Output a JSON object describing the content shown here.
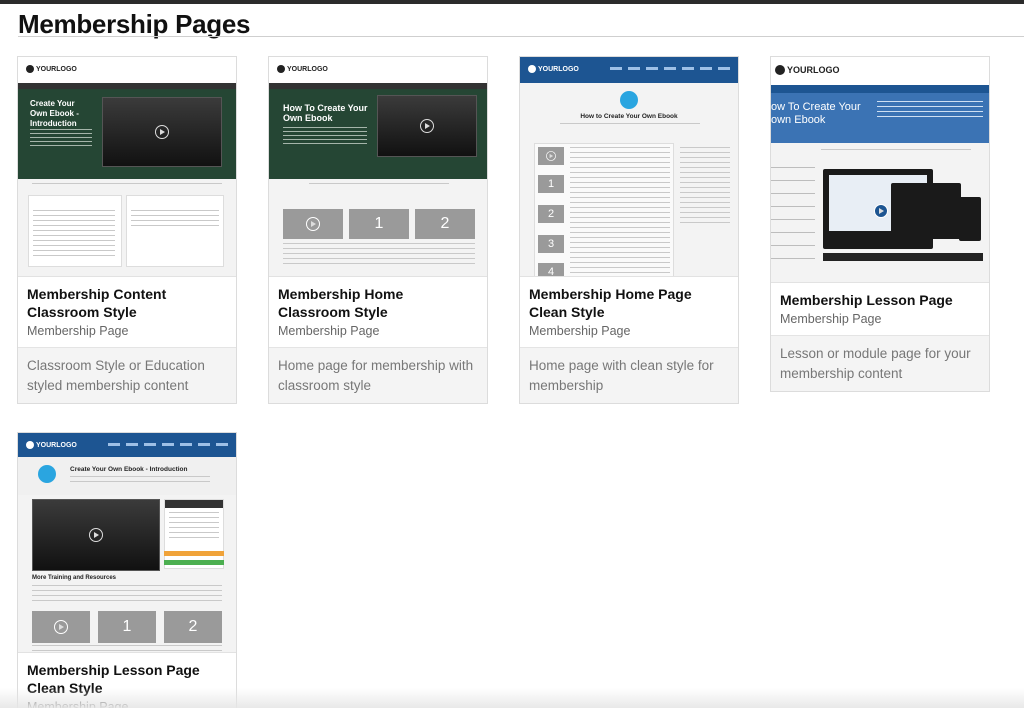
{
  "page": {
    "title": "Membership Pages"
  },
  "cards": [
    {
      "title": "Membership Content Classroom Style",
      "subtitle": "Membership Page",
      "description": "Classroom Style or Education styled membership content",
      "thumb": {
        "logo": "YOURLOGO",
        "heading": "Create Your Own Ebook - Introduction"
      }
    },
    {
      "title": "Membership Home Classroom Style",
      "subtitle": "Membership Page",
      "description": "Home page for membership with classroom style",
      "thumb": {
        "logo": "YOURLOGO",
        "heading": "How To Create Your Own Ebook",
        "numbers": [
          "1",
          "2"
        ]
      }
    },
    {
      "title": "Membership Home Page Clean Style",
      "subtitle": "Membership Page",
      "description": "Home page with clean style for membership",
      "thumb": {
        "logo": "YOURLOGO",
        "heading": "How to Create Your Own Ebook",
        "numbers": [
          "1",
          "2",
          "3",
          "4"
        ]
      }
    },
    {
      "title": "Membership Lesson Page",
      "subtitle": "Membership Page",
      "description": "Lesson or module page for your membership content",
      "thumb": {
        "logo": "YOURLOGO",
        "heading": "ow To Create Your own Ebook"
      }
    },
    {
      "title": "Membership Lesson Page Clean Style",
      "subtitle": "Membership Page",
      "description": "",
      "thumb": {
        "logo": "YOURLOGO",
        "heading": "Create Your Own Ebook - Introduction",
        "section": "More Training and Resources",
        "numbers": [
          "1",
          "2"
        ]
      }
    }
  ]
}
